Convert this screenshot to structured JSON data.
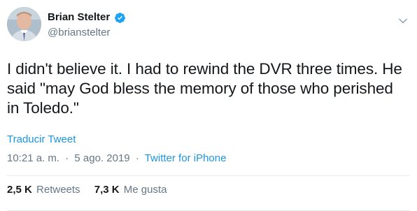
{
  "user": {
    "display_name": "Brian Stelter",
    "handle": "@brianstelter",
    "verified": true
  },
  "tweet": {
    "text": "I didn't believe it. I had to rewind the DVR three times. He said \"may God bless the memory of those who perished in Toledo.\"",
    "translate_label": "Traducir Tweet",
    "time": "10:21 a. m.",
    "separator": "·",
    "date": "5 ago. 2019",
    "source": "Twitter for iPhone"
  },
  "stats": {
    "retweets_count": "2,5 K",
    "retweets_label": "Retweets",
    "likes_count": "7,3 K",
    "likes_label": "Me gusta"
  },
  "icons": {
    "verified": "verified-badge-icon",
    "caret": "chevron-down-icon"
  },
  "colors": {
    "link": "#1b95e0",
    "secondary_text": "#657786",
    "primary_text": "#14171a",
    "divider": "#e6ecf0"
  }
}
